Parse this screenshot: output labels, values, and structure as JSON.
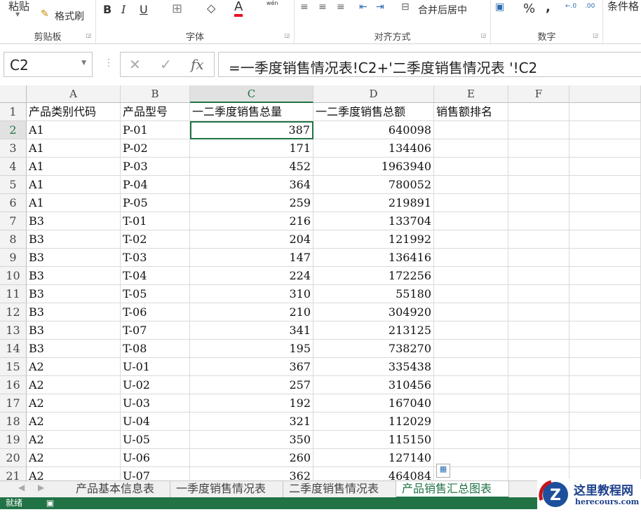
{
  "ribbon": {
    "clipboard": {
      "paste": "粘贴",
      "format_painter": "格式刷",
      "label": "剪贴板"
    },
    "font": {
      "bold": "B",
      "italic": "I",
      "underline": "U",
      "font_color_letter": "A",
      "phonetic": "wén",
      "label": "字体",
      "font_color": "#e81123"
    },
    "alignment": {
      "merge_center": "合并后居中",
      "label": "对齐方式"
    },
    "number": {
      "percent": "%",
      "comma": ",",
      "label": "数字"
    },
    "styles": {
      "conditional_format": "条件格"
    }
  },
  "formula_bar": {
    "name_box": "C2",
    "formula": "=一季度销售情况表!C2+'二季度销售情况表 '!C2",
    "fx": "fx"
  },
  "columns": [
    "A",
    "B",
    "C",
    "D",
    "E",
    "F"
  ],
  "selected_column": "C",
  "selected_row": 2,
  "rows": [
    {
      "n": "1",
      "a": "产品类别代码",
      "b": "产品型号",
      "c": "一二季度销售总量",
      "d": "一二季度销售总额",
      "e": "销售额排名"
    },
    {
      "n": "2",
      "a": "A1",
      "b": "P-01",
      "c": "387",
      "d": "640098"
    },
    {
      "n": "3",
      "a": "A1",
      "b": "P-02",
      "c": "171",
      "d": "134406"
    },
    {
      "n": "4",
      "a": "A1",
      "b": "P-03",
      "c": "452",
      "d": "1963940"
    },
    {
      "n": "5",
      "a": "A1",
      "b": "P-04",
      "c": "364",
      "d": "780052"
    },
    {
      "n": "6",
      "a": "A1",
      "b": "P-05",
      "c": "259",
      "d": "219891"
    },
    {
      "n": "7",
      "a": "B3",
      "b": "T-01",
      "c": "216",
      "d": "133704"
    },
    {
      "n": "8",
      "a": "B3",
      "b": "T-02",
      "c": "204",
      "d": "121992"
    },
    {
      "n": "9",
      "a": "B3",
      "b": "T-03",
      "c": "147",
      "d": "136416"
    },
    {
      "n": "10",
      "a": "B3",
      "b": "T-04",
      "c": "224",
      "d": "172256"
    },
    {
      "n": "11",
      "a": "B3",
      "b": "T-05",
      "c": "310",
      "d": "55180"
    },
    {
      "n": "12",
      "a": "B3",
      "b": "T-06",
      "c": "210",
      "d": "304920"
    },
    {
      "n": "13",
      "a": "B3",
      "b": "T-07",
      "c": "341",
      "d": "213125"
    },
    {
      "n": "14",
      "a": "B3",
      "b": "T-08",
      "c": "195",
      "d": "738270"
    },
    {
      "n": "15",
      "a": "A2",
      "b": "U-01",
      "c": "367",
      "d": "335438"
    },
    {
      "n": "16",
      "a": "A2",
      "b": "U-02",
      "c": "257",
      "d": "310456"
    },
    {
      "n": "17",
      "a": "A2",
      "b": "U-03",
      "c": "192",
      "d": "167040"
    },
    {
      "n": "18",
      "a": "A2",
      "b": "U-04",
      "c": "321",
      "d": "112029"
    },
    {
      "n": "19",
      "a": "A2",
      "b": "U-05",
      "c": "350",
      "d": "115150"
    },
    {
      "n": "20",
      "a": "A2",
      "b": "U-06",
      "c": "260",
      "d": "127140"
    },
    {
      "n": "21",
      "a": "A2",
      "b": "U-07",
      "c": "362",
      "d": "464084"
    }
  ],
  "sheet_tabs": [
    "产品基本信息表",
    "一季度销售情况表",
    "二季度销售情况表",
    "产品销售汇总图表"
  ],
  "active_tab": 3,
  "status": {
    "text": "就绪"
  },
  "watermark": {
    "name": "这里教程网",
    "url": "herecours.com"
  },
  "accent": "#217346"
}
